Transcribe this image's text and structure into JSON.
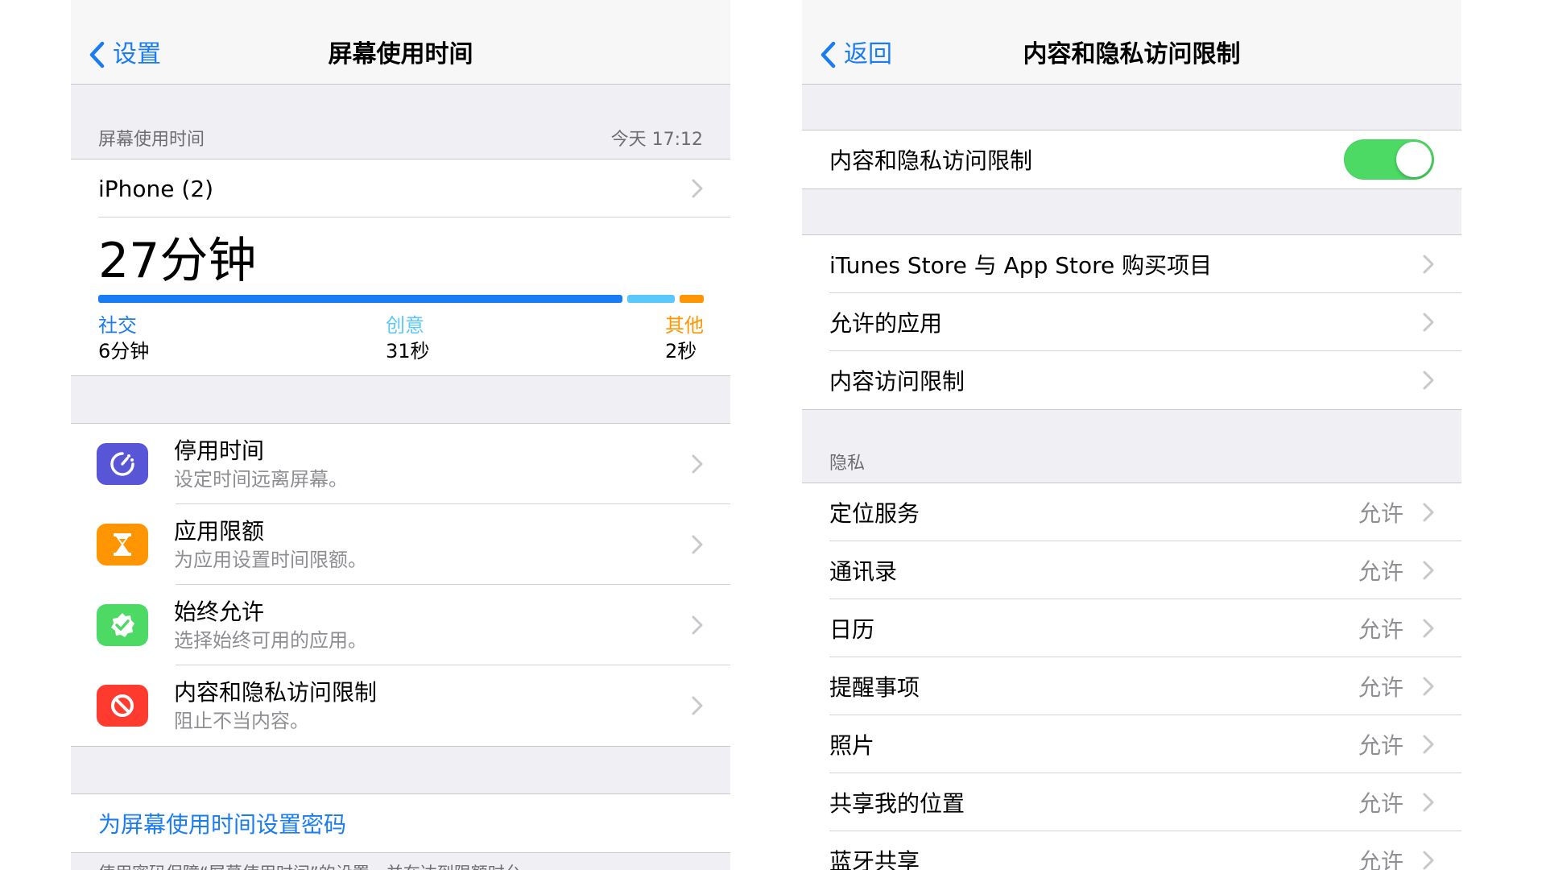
{
  "left": {
    "nav": {
      "back_label": "设置",
      "title": "屏幕使用时间"
    },
    "section": {
      "label": "屏幕使用时间",
      "timestamp": "今天 17:12"
    },
    "device_row": {
      "label": "iPhone (2)"
    },
    "usage": {
      "total": "27分钟",
      "categories": [
        {
          "name": "社交",
          "time": "6分钟",
          "color": "#1a7cf5",
          "share": 0.88
        },
        {
          "name": "创意",
          "time": "31秒",
          "color": "#5ac8fa",
          "share": 0.08
        },
        {
          "name": "其他",
          "time": "2秒",
          "color": "#ff9500",
          "share": 0.04
        }
      ]
    },
    "features": [
      {
        "title": "停用时间",
        "subtitle": "设定时间远离屏幕。",
        "icon": "downtime-icon",
        "color": "#5856d6"
      },
      {
        "title": "应用限额",
        "subtitle": "为应用设置时间限额。",
        "icon": "hourglass-icon",
        "color": "#ff9500"
      },
      {
        "title": "始终允许",
        "subtitle": "选择始终可用的应用。",
        "icon": "checkmark-badge-icon",
        "color": "#4cd964"
      },
      {
        "title": "内容和隐私访问限制",
        "subtitle": "阻止不当内容。",
        "icon": "restricted-icon",
        "color": "#ff3b30"
      }
    ],
    "passcode_link": "为屏幕使用时间设置密码",
    "footnote": "使用密码保障“屏幕使用时间”的设置，并在达到限额时允"
  },
  "right": {
    "nav": {
      "back_label": "返回",
      "title": "内容和隐私访问限制"
    },
    "toggle_row": {
      "label": "内容和隐私访问限制",
      "on": true
    },
    "store_rows": [
      {
        "label": "iTunes Store 与 App Store 购买项目"
      },
      {
        "label": "允许的应用"
      },
      {
        "label": "内容访问限制"
      }
    ],
    "privacy": {
      "header": "隐私",
      "rows": [
        {
          "label": "定位服务",
          "value": "允许"
        },
        {
          "label": "通讯录",
          "value": "允许"
        },
        {
          "label": "日历",
          "value": "允许"
        },
        {
          "label": "提醒事项",
          "value": "允许"
        },
        {
          "label": "照片",
          "value": "允许"
        },
        {
          "label": "共享我的位置",
          "value": "允许"
        },
        {
          "label": "蓝牙共享",
          "value": "允许"
        }
      ]
    }
  }
}
